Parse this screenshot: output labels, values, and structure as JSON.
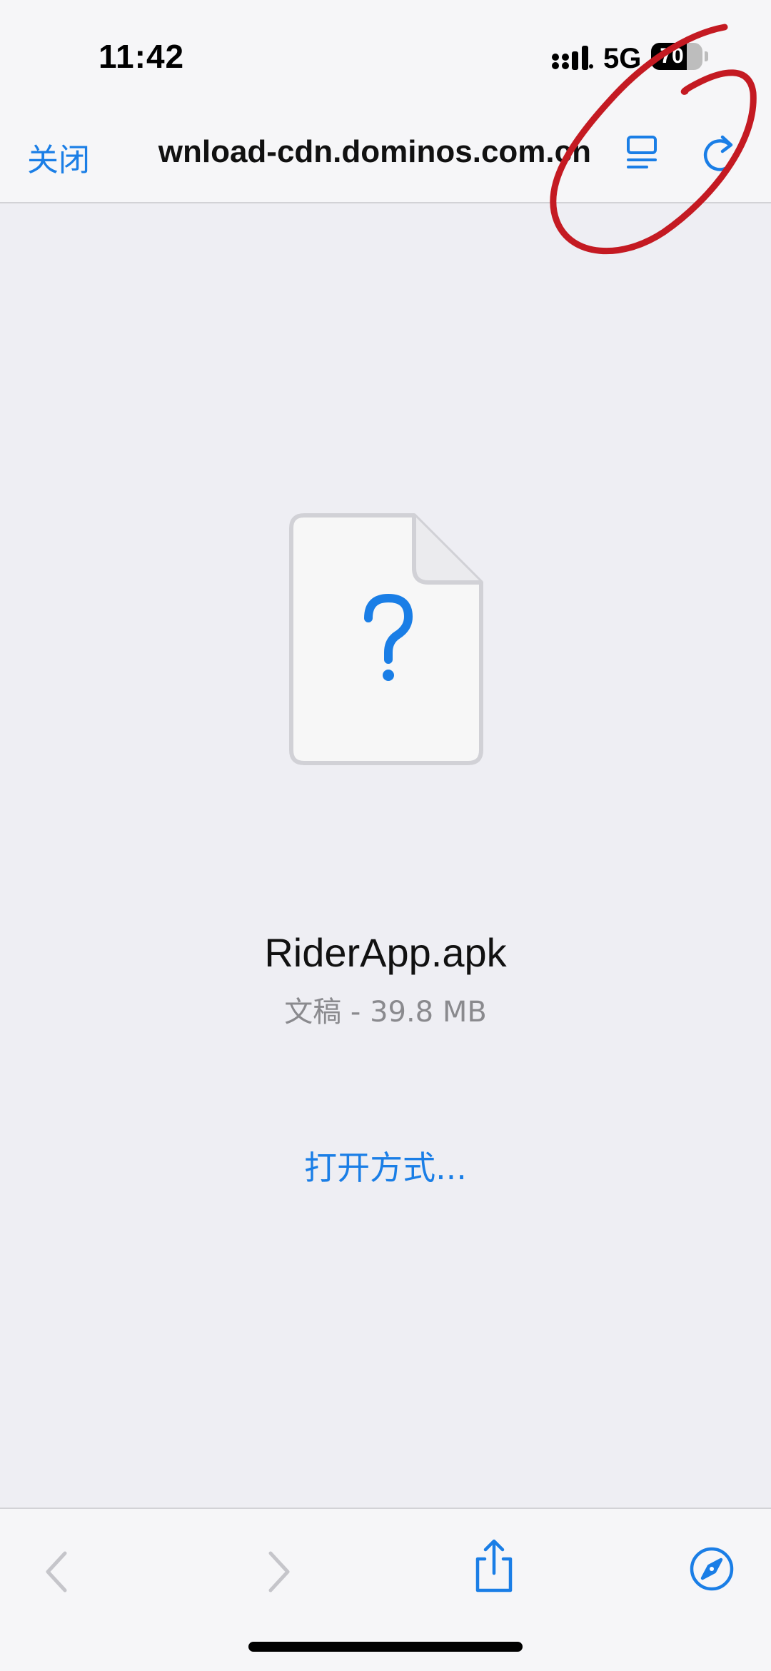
{
  "status_bar": {
    "time": "11:42",
    "network": "5G",
    "battery_level": "70",
    "battery_fraction": 0.7
  },
  "nav": {
    "close_label": "关闭",
    "url": "wnload-cdn.dominos.com.cn",
    "reader_icon": "reader-mode-icon",
    "reload_icon": "reload-icon"
  },
  "file": {
    "icon": "unknown-file-icon",
    "name": "RiderApp.apk",
    "meta": "文稿 - 39.8 MB",
    "open_with_label": "打开方式..."
  },
  "toolbar": {
    "icons": [
      "back-icon",
      "forward-icon",
      "share-icon",
      "compass-icon"
    ]
  },
  "colors": {
    "accent": "#1a7ee6",
    "annotation": "#c41a22",
    "background": "#eeeef3",
    "bar": "#f6f6f8"
  }
}
